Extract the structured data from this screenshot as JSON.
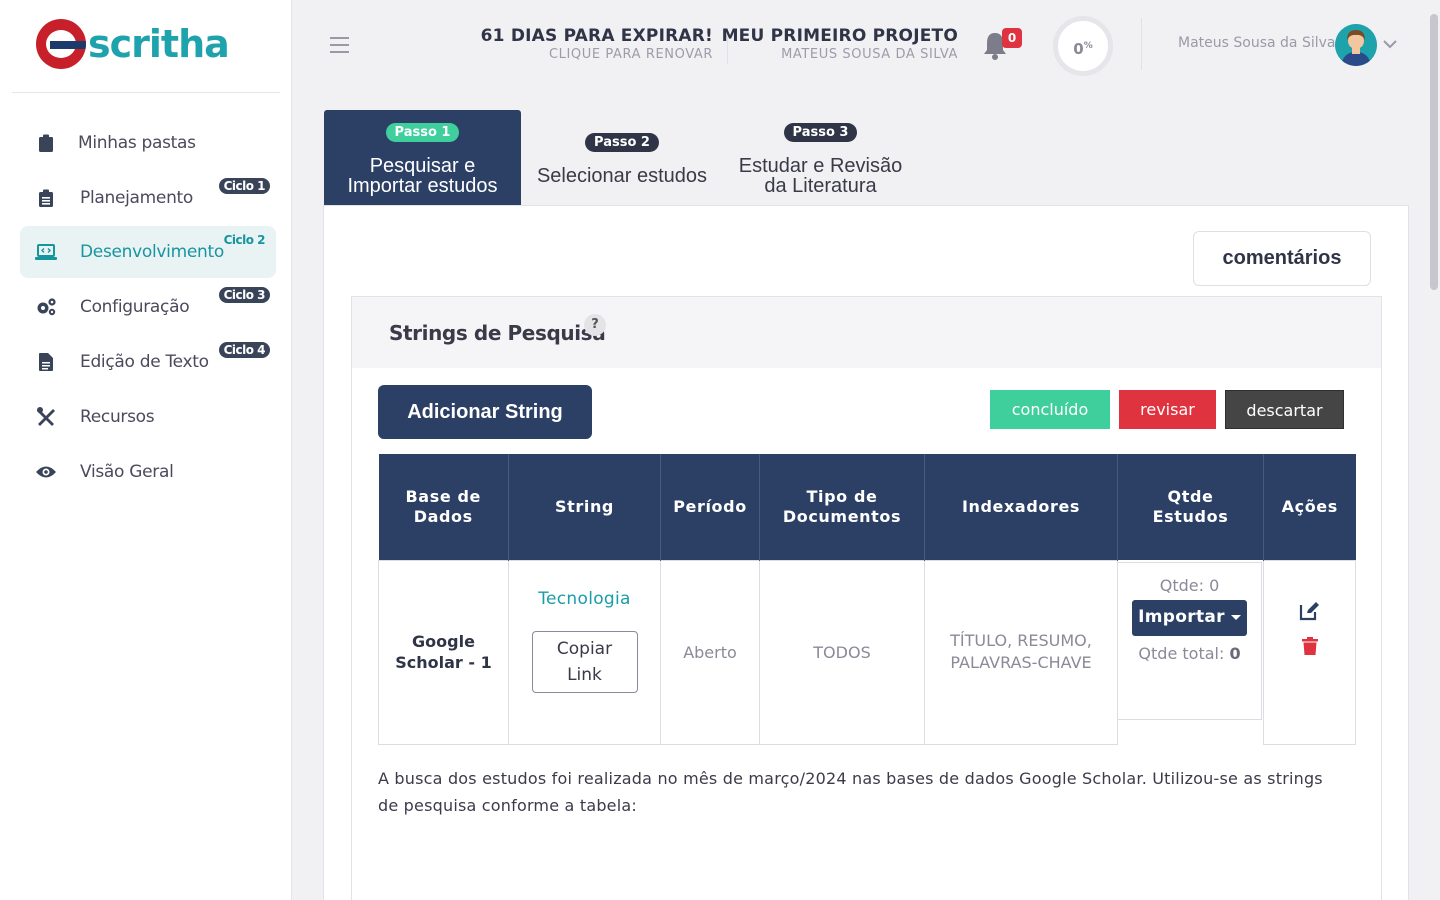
{
  "app": {
    "logo_text": "scritha"
  },
  "sidebar": {
    "items": [
      {
        "label": "Minhas pastas",
        "ciclo": ""
      },
      {
        "label": "Planejamento",
        "ciclo": "Ciclo 1"
      },
      {
        "label": "Desenvolvimento",
        "ciclo": "Ciclo 2"
      },
      {
        "label": "Configuração",
        "ciclo": "Ciclo 3"
      },
      {
        "label": "Edição de Texto",
        "ciclo": "Ciclo 4"
      },
      {
        "label": "Recursos",
        "ciclo": ""
      },
      {
        "label": "Visão Geral",
        "ciclo": ""
      }
    ]
  },
  "header": {
    "expiry_title": "61 DIAS PARA EXPIRAR!",
    "expiry_sub": "CLIQUE PARA RENOVAR",
    "project_title": "MEU PRIMEIRO PROJETO",
    "project_sub": "MATEUS SOUSA DA SILVA",
    "notifications": "0",
    "progress": "0",
    "progress_unit": "%",
    "user_name": "Mateus Sousa da Silva"
  },
  "steps": [
    {
      "badge": "Passo 1",
      "line1": "Pesquisar e",
      "line2": "Importar estudos"
    },
    {
      "badge": "Passo 2",
      "line1": "Selecionar estudos",
      "line2": ""
    },
    {
      "badge": "Passo 3",
      "line1": "Estudar e Revisão",
      "line2": "da Literatura"
    }
  ],
  "comments_label": "comentários",
  "card": {
    "title": "Strings de Pesquisa",
    "help": "?",
    "add_label": "Adicionar String",
    "done_label": "concluído",
    "review_label": "revisar",
    "discard_label": "descartar"
  },
  "table": {
    "headers": {
      "db_1": "Base de",
      "db_2": "Dados",
      "string": "String",
      "period": "Período",
      "doctype_1": "Tipo de",
      "doctype_2": "Documentos",
      "indexers": "Indexadores",
      "qtde_1": "Qtde",
      "qtde_2": "Estudos",
      "actions": "Ações"
    },
    "row": {
      "db_1": "Google",
      "db_2": "Scholar - 1",
      "string_link": "Tecnologia",
      "copy_1": "Copiar",
      "copy_2": "Link",
      "period": "Aberto",
      "doctype": "TODOS",
      "indexers_1": "TÍTULO, RESUMO,",
      "indexers_2": "PALAVRAS-CHAVE",
      "qtde": "Qtde: 0",
      "import_label": "Importar",
      "qtde_total_label": "Qtde total: ",
      "qtde_total": "0"
    }
  },
  "description": "A busca dos estudos foi realizada no mês de março/2024 nas bases de dados Google Scholar. Utilizou-se as strings de pesquisa conforme a tabela:",
  "colors": {
    "primary": "#2c4066",
    "accent": "#1ea3ad",
    "success": "#3fcf9c",
    "danger": "#e03340",
    "dark": "#454545"
  }
}
